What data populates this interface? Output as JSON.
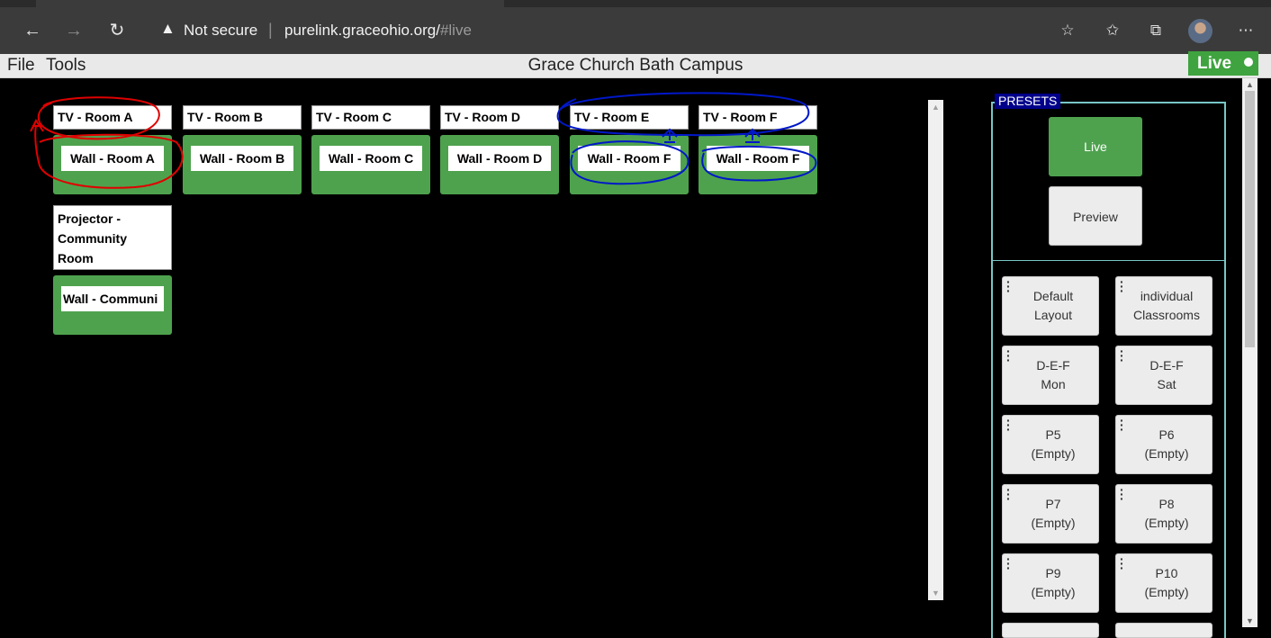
{
  "browser": {
    "security_label": "Not secure",
    "url_domain": "purelink.graceohio.org/",
    "url_fragment": "#live",
    "icons": [
      "back-arrow-icon",
      "forward-arrow-icon",
      "refresh-icon",
      "warning-icon",
      "add-favorite-icon",
      "favorites-icon",
      "collections-icon",
      "profile-avatar",
      "more-icon"
    ]
  },
  "menubar": {
    "file": "File",
    "tools": "Tools",
    "title": "Grace Church Bath Campus",
    "live": "Live"
  },
  "outputs": {
    "tv_a": "TV - Room A",
    "tv_b": "TV - Room B",
    "tv_c": "TV - Room C",
    "tv_d": "TV - Room D",
    "tv_e": "TV - Room E",
    "tv_f": "TV - Room F",
    "proj_1": "Projector -",
    "proj_2": "Community",
    "proj_3": "Room"
  },
  "sources": {
    "wall_a": "Wall - Room A",
    "wall_b": "Wall - Room B",
    "wall_c": "Wall - Room C",
    "wall_d": "Wall - Room D",
    "wall_e": "Wall - Room F",
    "wall_f": "Wall - Room F",
    "wall_comm": "Wall - Communi"
  },
  "presets": {
    "legend": "PRESETS",
    "live": "Live",
    "preview": "Preview",
    "p1_a": "Default",
    "p1_b": "Layout",
    "p2_a": "individual",
    "p2_b": "Classrooms",
    "p3_a": "D-E-F",
    "p3_b": "Mon",
    "p4_a": "D-E-F",
    "p4_b": "Sat",
    "p5_a": "P5",
    "p5_b": "(Empty)",
    "p6_a": "P6",
    "p6_b": "(Empty)",
    "p7_a": "P7",
    "p7_b": "(Empty)",
    "p8_a": "P8",
    "p8_b": "(Empty)",
    "p9_a": "P9",
    "p9_b": "(Empty)",
    "p10_a": "P10",
    "p10_b": "(Empty)"
  },
  "colors": {
    "accent_green": "#4ea24e",
    "live_badge": "#3fa33f",
    "presets_border": "#79c6c6",
    "legend_bg": "#00008b",
    "annotation_red": "#e00000",
    "annotation_blue": "#0018c8"
  }
}
